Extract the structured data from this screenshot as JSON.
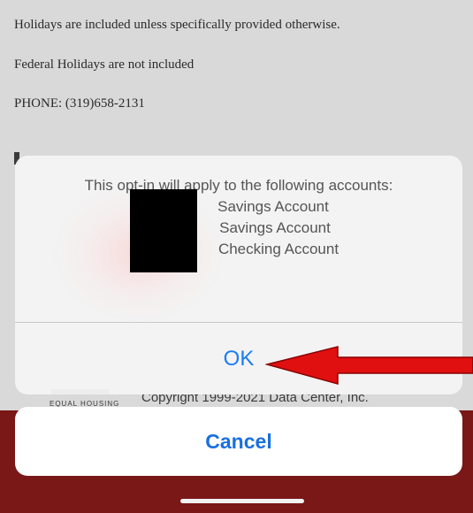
{
  "background": {
    "lines": [
      "Holidays are included unless specifically provided otherwise.",
      "Federal Holidays are not included",
      "PHONE: (319)658-2131"
    ],
    "copyright": "Copyright 1999-2021 Data Center, Inc.",
    "logo_text": "EQUAL HOUSING"
  },
  "alert": {
    "message": "This opt-in will apply to the following accounts:",
    "accounts": [
      "Savings Account",
      "Savings Account",
      "Checking Account"
    ],
    "ok_label": "OK"
  },
  "action_sheet": {
    "cancel_label": "Cancel"
  },
  "colors": {
    "accent": "#1a7cf2",
    "bottom_band": "#7a1717",
    "annotation_arrow": "#e01010"
  }
}
